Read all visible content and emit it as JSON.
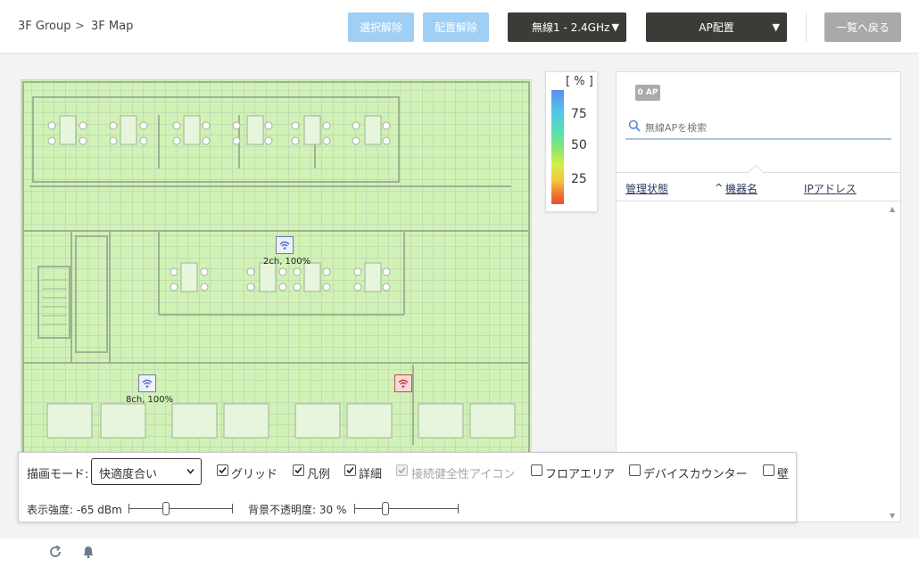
{
  "breadcrumb": {
    "group": "3F Group",
    "sep": ">",
    "map": "3F Map"
  },
  "toolbar": {
    "deselect_label": "選択解除",
    "unplace_label": "配置解除",
    "band_label": "無線1 - 2.4GHz",
    "ap_place_label": "AP配置",
    "back_label": "一覧へ戻る"
  },
  "legend": {
    "unit": "[ % ]",
    "v75": "75",
    "v50": "50",
    "v25": "25"
  },
  "aps": [
    {
      "label": "2ch, 100%",
      "status": "ok"
    },
    {
      "label": "8ch, 100%",
      "status": "ok"
    },
    {
      "label": "",
      "status": "alert"
    }
  ],
  "panel": {
    "count_badge": "0 AP",
    "search_placeholder": "無線APを検索",
    "col_status": "管理状態",
    "sort_indicator": "^",
    "col_name": "機器名",
    "col_ip": "IPアドレス"
  },
  "controls": {
    "render_mode_label": "描画モード:",
    "render_mode_value": "快適度合い",
    "grid_label": "グリッド",
    "legend_label": "凡例",
    "detail_label": "詳細",
    "health_icon_label": "接続健全性アイコン",
    "floor_area_label": "フロアエリア",
    "device_counter_label": "デバイスカウンター",
    "wall_label": "壁",
    "strength_label": "表示強度: -65 dBm",
    "opacity_label": "背景不透明度: 30 %",
    "grid_checked": true,
    "legend_checked": true,
    "detail_checked": true,
    "health_checked": true,
    "floor_area_checked": false,
    "device_counter_checked": false,
    "wall_checked": false,
    "strength_slider_fraction": 0.36,
    "opacity_slider_fraction": 0.3
  },
  "colors": {
    "accent_light": "#9fcff4",
    "dark_button": "#3d3b38",
    "heat_green": "#d0f2b6",
    "alert_red": "#d9534f"
  }
}
